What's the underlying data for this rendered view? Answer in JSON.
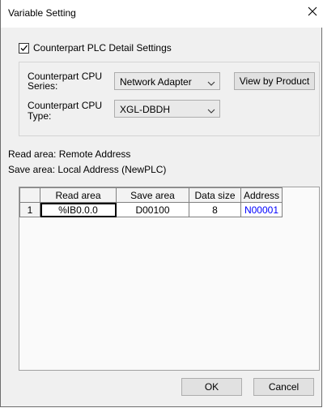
{
  "window": {
    "title": "Variable Setting"
  },
  "checkbox": {
    "label": "Counterpart PLC Detail Settings",
    "checked": true
  },
  "cpu_series": {
    "label_line1": "Counterpart CPU",
    "label_line2": "Series:",
    "value": "Network Adapter"
  },
  "cpu_type": {
    "label_line1": "Counterpart CPU",
    "label_line2": "Type:",
    "value": "XGL-DBDH"
  },
  "buttons": {
    "view_by_product": "View by Product",
    "ok": "OK",
    "cancel": "Cancel"
  },
  "info": {
    "read_area": "Read area: Remote Address",
    "save_area": "Save area: Local Address (NewPLC)"
  },
  "table": {
    "headers": [
      "",
      "Read area",
      "Save area",
      "Data size",
      "Address"
    ],
    "rows": [
      {
        "num": "1",
        "read_area": "%IB0.0.0",
        "save_area": "D00100",
        "data_size": "8",
        "address": "N00001"
      }
    ]
  },
  "colors": {
    "address_link": "#0000ff"
  }
}
